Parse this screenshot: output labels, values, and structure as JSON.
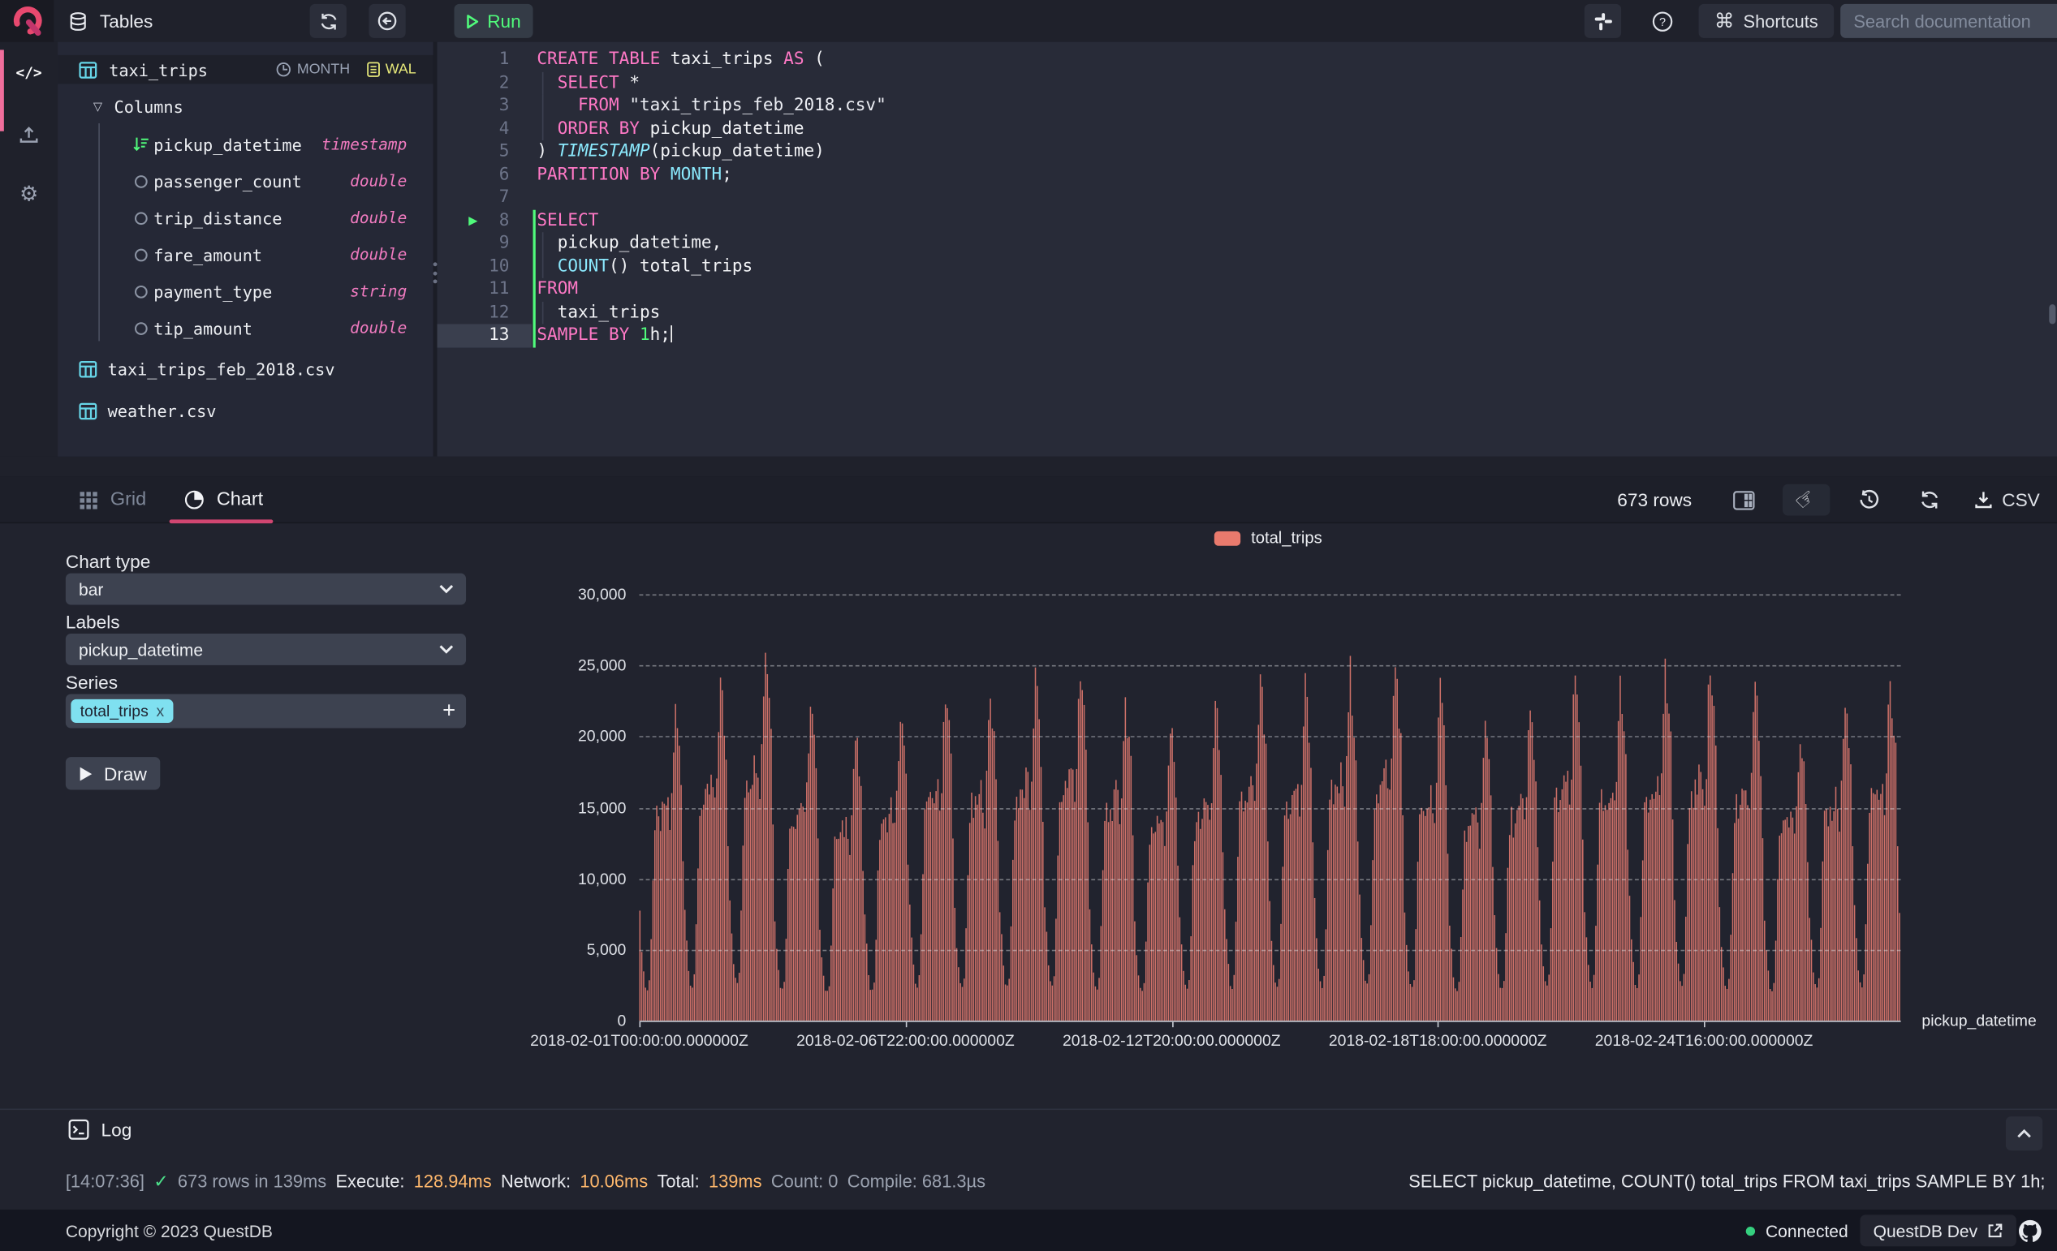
{
  "topbar": {
    "panel_title": "Tables",
    "run_label": "Run",
    "shortcuts_symbol": "⌘",
    "shortcuts_label": "Shortcuts",
    "search_placeholder": "Search documentation"
  },
  "schema": {
    "table": "taxi_trips",
    "partition_chip": "MONTH",
    "wal_chip": "WAL",
    "columns_label": "Columns",
    "columns": [
      {
        "name": "pickup_datetime",
        "type": "timestamp",
        "icon": "sort-desc-icon"
      },
      {
        "name": "passenger_count",
        "type": "double",
        "icon": "circle-icon"
      },
      {
        "name": "trip_distance",
        "type": "double",
        "icon": "circle-icon"
      },
      {
        "name": "fare_amount",
        "type": "double",
        "icon": "circle-icon"
      },
      {
        "name": "payment_type",
        "type": "string",
        "icon": "circle-icon"
      },
      {
        "name": "tip_amount",
        "type": "double",
        "icon": "circle-icon"
      }
    ],
    "other_tables": [
      "taxi_trips_feb_2018.csv",
      "weather.csv"
    ]
  },
  "editor": {
    "lines": [
      {
        "n": 1,
        "t": [
          [
            "k",
            "CREATE TABLE"
          ],
          [
            "p",
            " taxi_trips "
          ],
          [
            "k",
            "AS"
          ],
          [
            "p",
            " ("
          ]
        ]
      },
      {
        "n": 2,
        "guide": true,
        "t": [
          [
            "p",
            "  "
          ],
          [
            "k",
            "SELECT"
          ],
          [
            "p",
            " *"
          ]
        ]
      },
      {
        "n": 3,
        "guide": true,
        "t": [
          [
            "p",
            "    "
          ],
          [
            "k",
            "FROM"
          ],
          [
            "p",
            " "
          ],
          [
            "s",
            "\"taxi_trips_feb_2018.csv\""
          ]
        ]
      },
      {
        "n": 4,
        "guide": true,
        "t": [
          [
            "p",
            "  "
          ],
          [
            "k",
            "ORDER BY"
          ],
          [
            "p",
            " pickup_datetime"
          ]
        ]
      },
      {
        "n": 5,
        "t": [
          [
            "p",
            ") "
          ],
          [
            "fi",
            "TIMESTAMP"
          ],
          [
            "p",
            "(pickup_datetime)"
          ]
        ]
      },
      {
        "n": 6,
        "t": [
          [
            "k",
            "PARTITION BY"
          ],
          [
            "p",
            " "
          ],
          [
            "f",
            "MONTH"
          ],
          [
            "p",
            ";"
          ]
        ]
      },
      {
        "n": 7,
        "t": []
      },
      {
        "n": 8,
        "play": true,
        "stmt": true,
        "t": [
          [
            "k",
            "SELECT"
          ]
        ]
      },
      {
        "n": 9,
        "guide": true,
        "stmt": true,
        "t": [
          [
            "p",
            "  pickup_datetime,"
          ]
        ]
      },
      {
        "n": 10,
        "guide": true,
        "stmt": true,
        "t": [
          [
            "p",
            "  "
          ],
          [
            "f",
            "COUNT"
          ],
          [
            "p",
            "() total_trips"
          ]
        ]
      },
      {
        "n": 11,
        "stmt": true,
        "t": [
          [
            "k",
            "FROM"
          ]
        ]
      },
      {
        "n": 12,
        "guide": true,
        "stmt": true,
        "t": [
          [
            "p",
            "  taxi_trips"
          ]
        ]
      },
      {
        "n": 13,
        "stmt": true,
        "cur": true,
        "t": [
          [
            "k",
            "SAMPLE BY"
          ],
          [
            "p",
            " "
          ],
          [
            "n",
            "1"
          ],
          [
            "p",
            "h;"
          ]
        ]
      }
    ]
  },
  "results": {
    "tab_grid": "Grid",
    "tab_chart": "Chart",
    "rows_count": "673 rows",
    "csv_label": "CSV"
  },
  "chart_config": {
    "type_label": "Chart type",
    "type_value": "bar",
    "labels_label": "Labels",
    "labels_value": "pickup_datetime",
    "series_label": "Series",
    "series_chip": "total_trips",
    "series_chip_close": "x",
    "add_series": "+",
    "draw_label": "Draw"
  },
  "chart_data": {
    "type": "bar",
    "series_name": "total_trips",
    "bar_color": "#cd7068",
    "legend_color": "#e97a6d",
    "xlabel": "pickup_datetime",
    "ylim": [
      0,
      30000
    ],
    "n_points": 673,
    "interval": "1h",
    "start": "2018-02-01T00:00:00.000000Z",
    "yticks": [
      {
        "v": 0,
        "label": "0"
      },
      {
        "v": 5000,
        "label": "5,000"
      },
      {
        "v": 10000,
        "label": "10,000"
      },
      {
        "v": 15000,
        "label": "15,000"
      },
      {
        "v": 20000,
        "label": "20,000"
      },
      {
        "v": 25000,
        "label": "25,000"
      },
      {
        "v": 30000,
        "label": "30,000"
      }
    ],
    "xticks": [
      {
        "index": 0,
        "label": "2018-02-01T00:00:00.000000Z"
      },
      {
        "index": 142,
        "label": "2018-02-06T22:00:00.000000Z"
      },
      {
        "index": 284,
        "label": "2018-02-12T20:00:00.000000Z"
      },
      {
        "index": 426,
        "label": "2018-02-18T18:00:00.000000Z"
      },
      {
        "index": 568,
        "label": "2018-02-24T16:00:00.000000Z"
      }
    ],
    "hourly_profile": [
      0.34,
      0.24,
      0.16,
      0.11,
      0.1,
      0.13,
      0.28,
      0.47,
      0.62,
      0.66,
      0.64,
      0.65,
      0.67,
      0.68,
      0.71,
      0.69,
      0.63,
      0.73,
      0.9,
      1.0,
      0.95,
      0.88,
      0.78,
      0.55
    ],
    "daily_peaks": [
      21500,
      23500,
      26300,
      22000,
      19800,
      21200,
      23300,
      22800,
      23800,
      24800,
      22400,
      20600,
      21800,
      23500,
      23200,
      24200,
      25000,
      22600,
      20400,
      21600,
      23900,
      23400,
      24400,
      24800,
      22800,
      20800,
      22300,
      23600
    ],
    "last_point": 7600
  },
  "log": {
    "title": "Log",
    "segments": [
      {
        "t": "[14:07:36]",
        "c": "dim"
      },
      {
        "t": "✓",
        "c": "ok"
      },
      {
        "t": "673 rows in 139ms",
        "c": "dim"
      },
      {
        "t": "Execute:",
        "c": "w"
      },
      {
        "t": "128.94ms",
        "c": "orange"
      },
      {
        "t": "Network:",
        "c": "w"
      },
      {
        "t": "10.06ms",
        "c": "orange"
      },
      {
        "t": "Total:",
        "c": "w"
      },
      {
        "t": "139ms",
        "c": "orange"
      },
      {
        "t": "Count: 0",
        "c": "dim"
      },
      {
        "t": "Compile: 681.3µs",
        "c": "dim"
      }
    ],
    "query": "SELECT pickup_datetime, COUNT() total_trips FROM taxi_trips  SAMPLE BY 1h;"
  },
  "footer": {
    "copyright": "Copyright © 2023 QuestDB",
    "connected": "Connected",
    "instance": "QuestDB Dev"
  }
}
